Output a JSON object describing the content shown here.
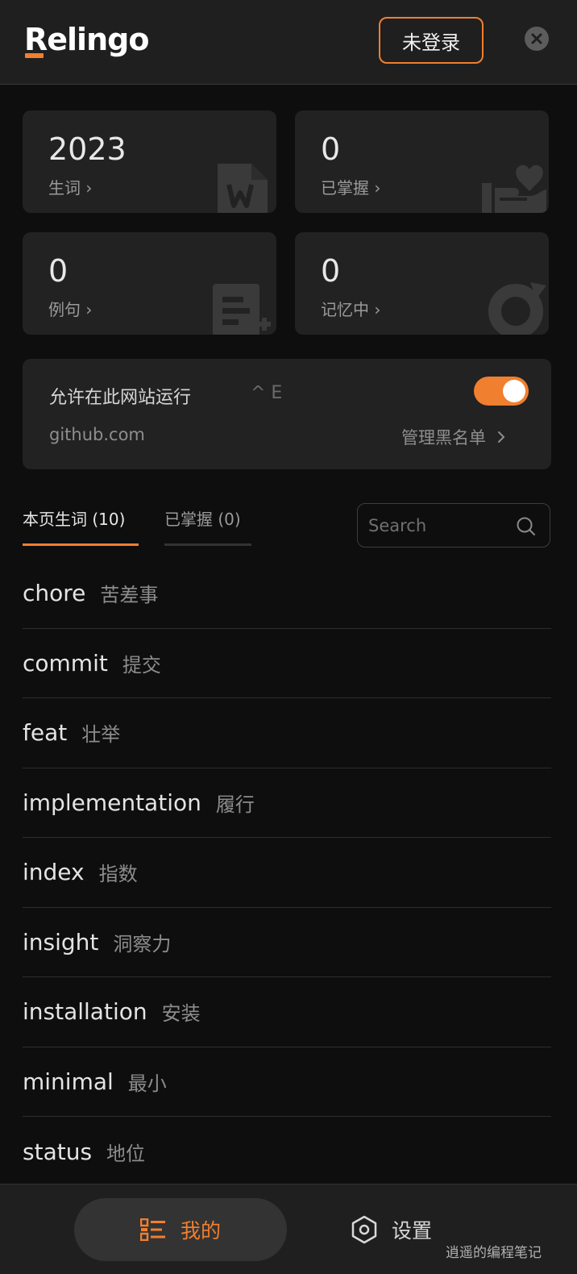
{
  "header": {
    "logo": "Relingo",
    "login_label": "未登录"
  },
  "stats": [
    {
      "value": "2023",
      "label": "生词 ›",
      "icon": "wordbook-icon"
    },
    {
      "value": "0",
      "label": "已掌握 ›",
      "icon": "mastered-heart-icon"
    },
    {
      "value": "0",
      "label": "例句 ›",
      "icon": "sentence-doc-icon"
    },
    {
      "value": "0",
      "label": "记忆中 ›",
      "icon": "memory-cycle-icon"
    }
  ],
  "site": {
    "title": "允许在此网站运行",
    "shortcut": "^ E",
    "enabled": true,
    "domain": "github.com",
    "blacklist_label": "管理黑名单"
  },
  "tabs": [
    {
      "label": "本页生词 (10)",
      "active": true
    },
    {
      "label": "已掌握 (0)",
      "active": false
    }
  ],
  "search": {
    "placeholder": "Search",
    "value": ""
  },
  "words": [
    {
      "en": "chore",
      "zh": "苦差事"
    },
    {
      "en": "commit",
      "zh": "提交"
    },
    {
      "en": "feat",
      "zh": "壮举"
    },
    {
      "en": "implementation",
      "zh": "履行"
    },
    {
      "en": "index",
      "zh": "指数"
    },
    {
      "en": "insight",
      "zh": "洞察力"
    },
    {
      "en": "installation",
      "zh": "安装"
    },
    {
      "en": "minimal",
      "zh": "最小"
    },
    {
      "en": "status",
      "zh": "地位"
    }
  ],
  "nav": {
    "mine_label": "我的",
    "settings_label": "设置"
  },
  "watermark": "逍遥的编程笔记",
  "colors": {
    "accent": "#f07f2f",
    "background": "#0e0e0e",
    "card": "#222222"
  }
}
